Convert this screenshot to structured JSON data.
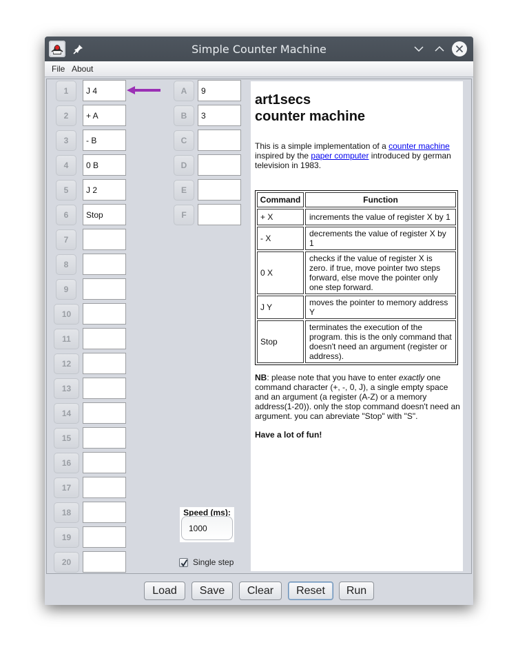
{
  "window": {
    "title": "Simple Counter Machine",
    "icons": {
      "app": "java-duke-icon",
      "pin": "pin-icon",
      "minimize": "chevron-down-icon",
      "maximize": "chevron-up-icon",
      "close": "close-icon"
    }
  },
  "menu": {
    "items": [
      {
        "label": "File"
      },
      {
        "label": "About"
      }
    ]
  },
  "program": {
    "pointer_address": 1,
    "pointer_color": "#9b30b5",
    "rows": [
      {
        "address": "1",
        "value": "J 4"
      },
      {
        "address": "2",
        "value": "+ A"
      },
      {
        "address": "3",
        "value": "- B"
      },
      {
        "address": "4",
        "value": "0 B"
      },
      {
        "address": "5",
        "value": "J 2"
      },
      {
        "address": "6",
        "value": "Stop"
      },
      {
        "address": "7",
        "value": ""
      },
      {
        "address": "8",
        "value": ""
      },
      {
        "address": "9",
        "value": ""
      },
      {
        "address": "10",
        "value": ""
      },
      {
        "address": "11",
        "value": ""
      },
      {
        "address": "12",
        "value": ""
      },
      {
        "address": "13",
        "value": ""
      },
      {
        "address": "14",
        "value": ""
      },
      {
        "address": "15",
        "value": ""
      },
      {
        "address": "16",
        "value": ""
      },
      {
        "address": "17",
        "value": ""
      },
      {
        "address": "18",
        "value": ""
      },
      {
        "address": "19",
        "value": ""
      },
      {
        "address": "20",
        "value": ""
      }
    ]
  },
  "registers": [
    {
      "name": "A",
      "value": "9"
    },
    {
      "name": "B",
      "value": "3"
    },
    {
      "name": "C",
      "value": ""
    },
    {
      "name": "D",
      "value": ""
    },
    {
      "name": "E",
      "value": ""
    },
    {
      "name": "F",
      "value": ""
    }
  ],
  "controls": {
    "speed_label": "Speed (ms):",
    "speed_value": "1000",
    "single_step_label": "Single step",
    "single_step_checked": true
  },
  "info": {
    "title_line1": "art1secs",
    "title_line2": "counter machine",
    "intro_prefix": "This is a simple implementation of a ",
    "link_counter_machine": "counter machine",
    "intro_middle": " inspired by the ",
    "link_paper_computer": "paper computer",
    "intro_suffix": " introduced by german television in 1983.",
    "table": {
      "headers": [
        "Command",
        "Function"
      ],
      "rows": [
        {
          "command": "+ X",
          "function": "increments the value of register X by 1"
        },
        {
          "command": "- X",
          "function": "decrements the value of register X by 1"
        },
        {
          "command": "0 X",
          "function": "checks if the value of register X is zero. if true, move pointer two steps forward, else move the pointer only one step forward."
        },
        {
          "command": "J Y",
          "function": "moves the pointer to memory address Y"
        },
        {
          "command": "Stop",
          "function": "terminates the execution of the program. this is the only command that doesn't need an argument (register or address)."
        }
      ]
    },
    "note_label": "NB",
    "note_prefix": ": please note that you have to enter ",
    "note_emphasis": "exactly",
    "note_suffix": " one command character (+, -, 0, J), a single empty space and an argument (a register (A-Z) or a memory address(1-20)). only the stop command doesn't need an argument. you can abreviate \"Stop\" with \"S\".",
    "closing": "Have a lot of fun!",
    "link_color": "#0000ee"
  },
  "buttons": {
    "load": "Load",
    "save": "Save",
    "clear": "Clear",
    "reset": "Reset",
    "run": "Run"
  }
}
